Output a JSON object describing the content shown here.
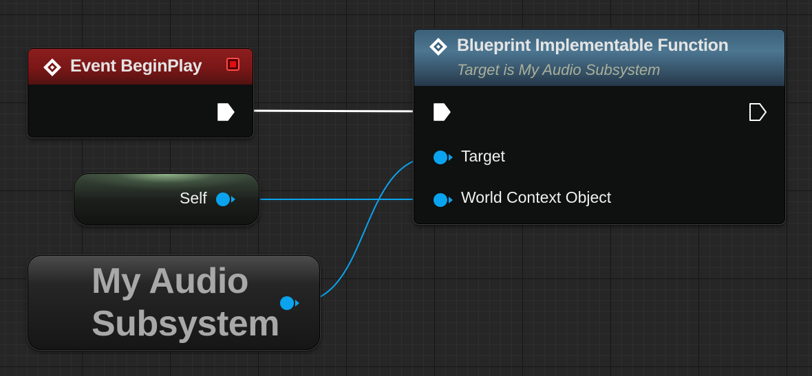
{
  "event_node": {
    "title": "Event BeginPlay"
  },
  "function_node": {
    "title": "Blueprint Implementable Function",
    "subtitle": "Target is My Audio Subsystem",
    "pins": {
      "target": "Target",
      "world_context": "World Context Object"
    }
  },
  "self_node": {
    "label": "Self"
  },
  "subsystem_node": {
    "title_line1": "My Audio",
    "title_line2": "Subsystem"
  },
  "colors": {
    "object_pin": "#0aa3ef",
    "exec_wire": "#ffffff",
    "event_header": "#8c1e1e",
    "function_header": "#4c7691",
    "self_highlight": "#a0c896"
  },
  "icons": {
    "event": "event-diamond-icon",
    "function": "function-diamond-icon",
    "breakpoint": "stop-icon"
  }
}
